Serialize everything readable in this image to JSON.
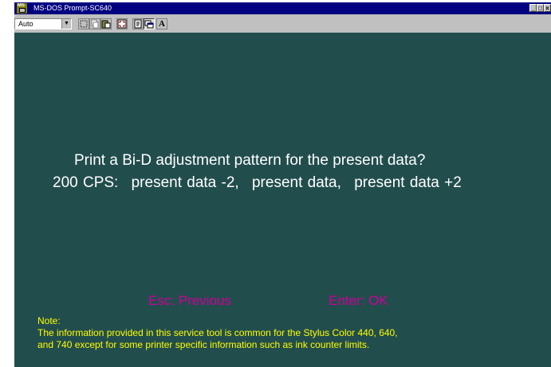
{
  "window": {
    "title": "MS-DOS Prompt-SC640",
    "icon_text": "MS",
    "controls": {
      "minimize": "_",
      "maximize": "□",
      "close": "×"
    }
  },
  "toolbar": {
    "font_select_value": "Auto",
    "buttons": [
      "mark-icon",
      "copy-icon",
      "paste-icon",
      "fullscreen-icon",
      "properties-icon",
      "background-icon",
      "font-icon"
    ],
    "font_button_label": "A"
  },
  "console": {
    "prompt_line": "Print a Bi-D adjustment pattern for the present data?",
    "speed": "200 CPS:",
    "options": [
      "present data -2,",
      "present data,",
      "present data +2"
    ],
    "esc_label": "Esc:  Previous",
    "enter_label": "Enter: OK",
    "note_label": "Note:",
    "note_line1": "The information provided in this service tool is common for the Stylus Color 440, 640,",
    "note_line2": "and 740 except for some printer specific information such as ink counter limits."
  },
  "colors": {
    "console_background": "#224d4d",
    "title_bar": "#000080",
    "prompt_text": "#ffffff",
    "key_text": "#cc0099",
    "note_text": "#ffff00"
  }
}
